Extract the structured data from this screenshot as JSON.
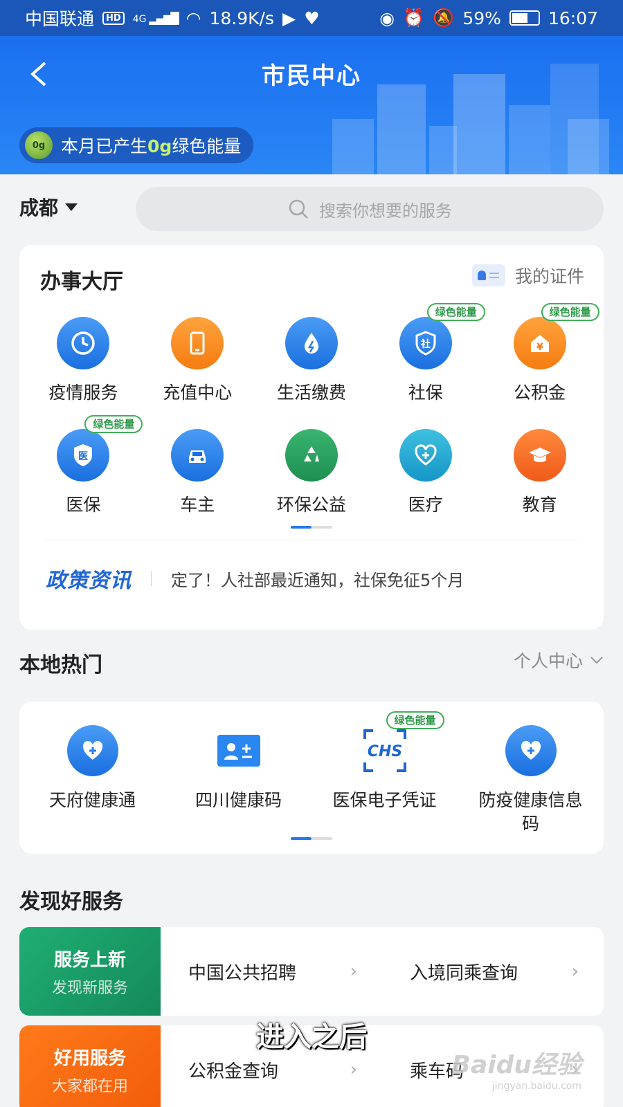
{
  "status_bar": {
    "carrier": "中国联通",
    "hd": "HD",
    "network": "4G",
    "speed": "18.9K/s",
    "battery": "59%",
    "time": "16:07"
  },
  "header": {
    "title": "市民中心",
    "energy": {
      "badge": "0g",
      "prefix": "本月已产生",
      "value": "0g",
      "suffix": "绿色能量"
    }
  },
  "search": {
    "city": "成都",
    "placeholder": "搜索你想要的服务"
  },
  "hall": {
    "title": "办事大厅",
    "my_cert_label": "我的证件",
    "green_badge": "绿色能量",
    "row1": [
      {
        "label": "疫情服务",
        "icon": "clock-refresh-icon"
      },
      {
        "label": "充值中心",
        "icon": "phone-icon"
      },
      {
        "label": "生活缴费",
        "icon": "water-bolt-icon"
      },
      {
        "label": "社保",
        "icon": "shield-icon",
        "glyph": "社",
        "badge": true
      },
      {
        "label": "公积金",
        "icon": "house-yen-icon",
        "glyph": "¥",
        "badge": true
      }
    ],
    "row2": [
      {
        "label": "医保",
        "icon": "shield-icon",
        "glyph": "医",
        "badge": true
      },
      {
        "label": "车主",
        "icon": "car-icon"
      },
      {
        "label": "环保公益",
        "icon": "recycle-icon"
      },
      {
        "label": "医疗",
        "icon": "stethoscope-icon"
      },
      {
        "label": "教育",
        "icon": "graduation-cap-icon"
      }
    ],
    "policy": {
      "logo": "政策资讯",
      "headline": "定了！人社部最近通知，社保免征5个月"
    }
  },
  "local_hot": {
    "title": "本地热门",
    "personal_center": "个人中心",
    "items": [
      {
        "label": "天府健康通",
        "icon": "heart-plus-icon"
      },
      {
        "label": "四川健康码",
        "icon": "id-card-icon"
      },
      {
        "label": "医保电子凭证",
        "icon": "chs-scan-icon",
        "badge": true,
        "glyph": "CHS"
      },
      {
        "label": "防疫健康信息码",
        "icon": "heart-plus-icon"
      }
    ]
  },
  "discover": {
    "title": "发现好服务",
    "promos": [
      {
        "tag_title": "服务上新",
        "tag_sub": "发现新服务",
        "items": [
          "中国公共招聘",
          "入境同乘查询"
        ]
      },
      {
        "tag_title": "好用服务",
        "tag_sub": "大家都在用",
        "items": [
          "公积金查询",
          "乘车码"
        ]
      }
    ]
  },
  "overlay": {
    "caption": "进入之后",
    "watermark_brand": "Baidu经验",
    "watermark_url": "jingyan.baidu.com"
  },
  "colors": {
    "header_blue": "#1a6ff0",
    "status_bar": "#1b57b8",
    "badge_green": "#2e9a4a",
    "promo_green": "#1fae72",
    "promo_orange": "#ff7a1a"
  }
}
